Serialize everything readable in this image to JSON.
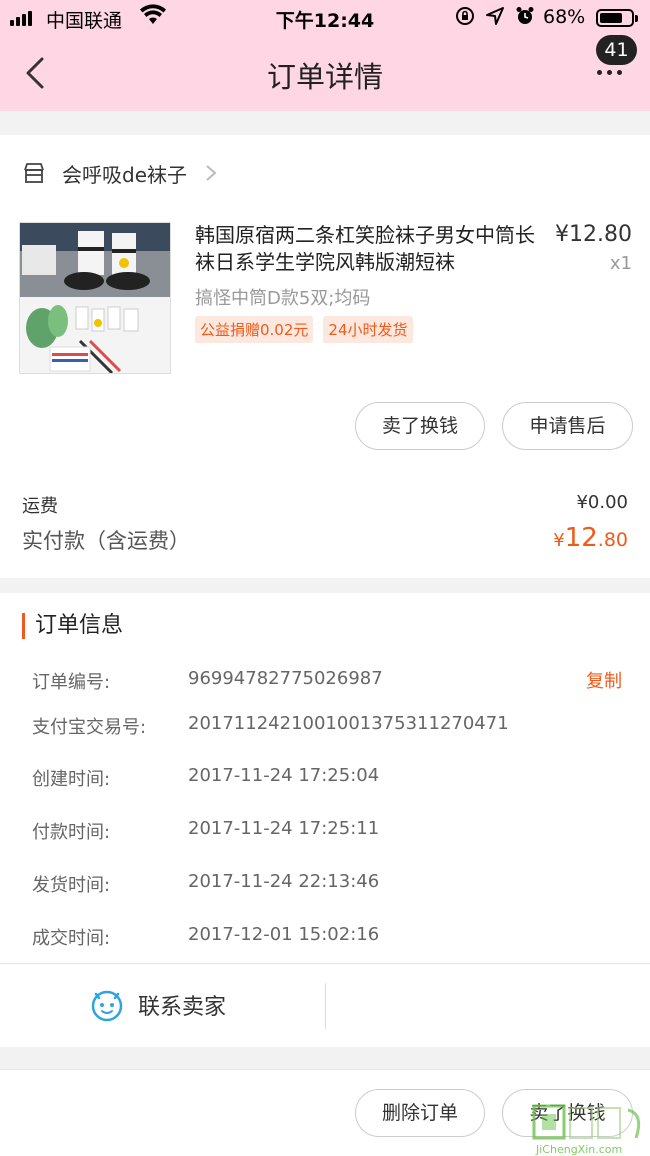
{
  "status_bar": {
    "carrier": "中国联通",
    "time": "下午12:44",
    "battery": "68%"
  },
  "nav": {
    "title": "订单详情",
    "badge": "41"
  },
  "shop": {
    "name": "会呼吸de袜子"
  },
  "product": {
    "title": "韩国原宿两二条杠笑脸袜子男女中筒长袜日系学生学院风韩版潮短袜",
    "price": "¥12.80",
    "qty": "x1",
    "sku": "搞怪中筒D款5双;均码",
    "tags": [
      "公益捐赠0.02元",
      "24小时发货"
    ]
  },
  "item_actions": {
    "sell": "卖了换钱",
    "after_sale": "申请售后"
  },
  "cost": {
    "shipping_label": "运费",
    "shipping_value": "¥0.00",
    "paid_label": "实付款（含运费）",
    "paid_symbol": "¥",
    "paid_int": "12",
    "paid_dec": ".80"
  },
  "order_info": {
    "title": "订单信息",
    "copy": "复制",
    "rows": [
      {
        "label": "订单编号:",
        "value": "96994782775026987"
      },
      {
        "label": "支付宝交易号:",
        "value": "2017112421001001375311270471"
      },
      {
        "label": "创建时间:",
        "value": "2017-11-24 17:25:04"
      },
      {
        "label": "付款时间:",
        "value": "2017-11-24 17:25:11"
      },
      {
        "label": "发货时间:",
        "value": "2017-11-24 22:13:46"
      },
      {
        "label": "成交时间:",
        "value": "2017-12-01 15:02:16"
      }
    ]
  },
  "contact": {
    "label": "联系卖家"
  },
  "bottom_actions": {
    "delete": "删除订单",
    "sell": "卖了换钱"
  },
  "watermark": {
    "text": "JiChengXin.com"
  },
  "colors": {
    "header_bg": "#fed6e4",
    "accent": "#f05a1a",
    "contact_icon": "#2ea3e3"
  }
}
